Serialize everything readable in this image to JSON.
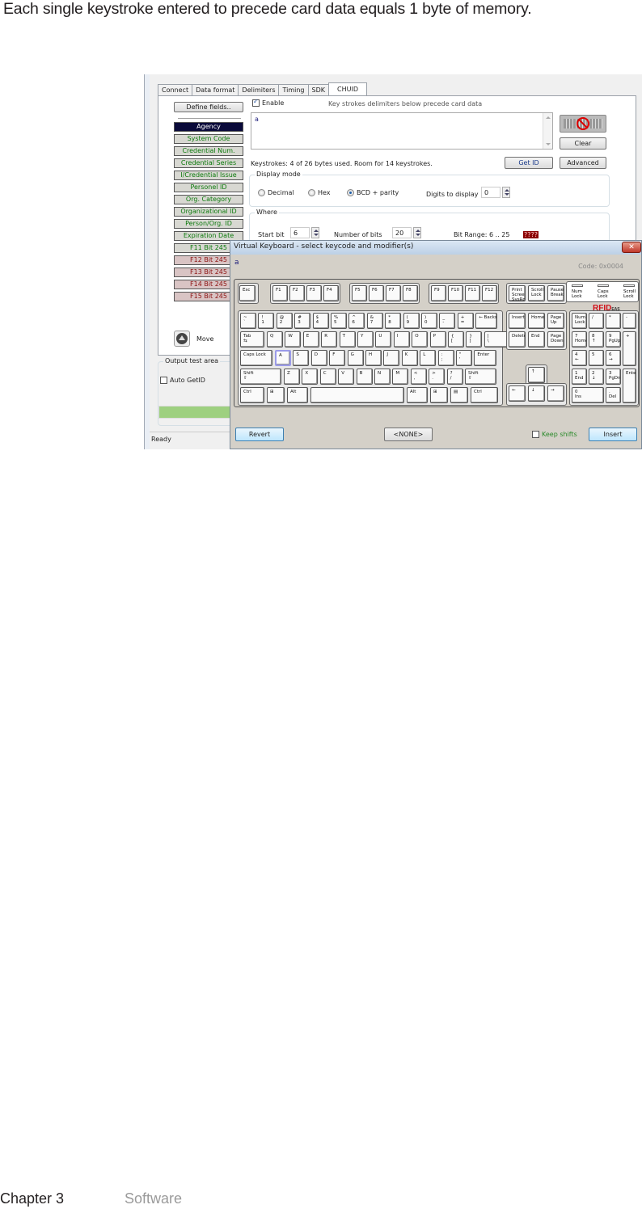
{
  "caption": "Each single keystroke entered to precede card data equals 1 byte of memory.",
  "footer": {
    "chapter": "Chapter 3",
    "section": "Software"
  },
  "app": {
    "tabs": [
      "Connect",
      "Data format",
      "Delimiters",
      "Timing",
      "SDK",
      "CHUID"
    ],
    "active_tab": "CHUID",
    "define_fields": "Define fields..",
    "fields": [
      {
        "label": "Agency",
        "state": "selected"
      },
      {
        "label": "System Code",
        "state": "green"
      },
      {
        "label": "Credential Num.",
        "state": "green"
      },
      {
        "label": "Credential Series",
        "state": "green"
      },
      {
        "label": "I/Credential Issue",
        "state": "green"
      },
      {
        "label": "Personel ID",
        "state": "green"
      },
      {
        "label": "Org. Category",
        "state": "green"
      },
      {
        "label": "Organizational ID",
        "state": "green"
      },
      {
        "label": "Person/Org. ID",
        "state": "green"
      },
      {
        "label": "Expiration Date",
        "state": "green"
      },
      {
        "label": "F11 Bit 245",
        "state": "green"
      },
      {
        "label": "F12 Bit 245",
        "state": "red"
      },
      {
        "label": "F13 Bit 245",
        "state": "red"
      },
      {
        "label": "F14 Bit 245",
        "state": "red"
      },
      {
        "label": "F15 Bit 245",
        "state": "red"
      }
    ],
    "move_label": "Move",
    "enable_label": "Enable",
    "enable_checked": true,
    "hint": "Key strokes delimiters below precede card data",
    "keystroke_value": "a",
    "clear": "Clear",
    "get_id": "Get ID",
    "advanced": "Advanced",
    "keystrokes_status": "Keystrokes: 4 of 26 bytes used. Room for 14 keystrokes.",
    "display_mode": {
      "title": "Display mode",
      "options": [
        "Decimal",
        "Hex",
        "BCD + parity"
      ],
      "selected": "BCD + parity",
      "digits_label": "Digits to display",
      "digits_value": "0"
    },
    "where": {
      "title": "Where",
      "start_bit_label": "Start bit",
      "start_bit": "6",
      "num_bits_label": "Number of bits",
      "num_bits": "20",
      "bit_range": "Bit Range: 6 .. 25",
      "bit_error": "????"
    },
    "output": {
      "title": "Output test area",
      "auto_getid": "Auto GetID",
      "auto_getid_checked": false
    },
    "status": "Ready"
  },
  "vk": {
    "title": "Virtual Keyboard - select keycode and modifier(s)",
    "close": "✕",
    "selected_char": "a",
    "code": "Code: 0x0004",
    "leds": [
      "Num\nLock",
      "Caps\nLock",
      "Scroll\nLock"
    ],
    "brand": "RFID",
    "brand_suffix": "EAS",
    "revert": "Revert",
    "none": "<NONE>",
    "keep_shifts": "Keep shifts",
    "insert": "Insert",
    "keys": {
      "esc": "Esc",
      "f": [
        "F1",
        "F2",
        "F3",
        "F4",
        "F5",
        "F6",
        "F7",
        "F8",
        "F9",
        "F10",
        "F11",
        "F12"
      ],
      "sys": [
        "Print\nScreen\nSysRq",
        "Scroll\nLock",
        "Pause\nBreak"
      ],
      "row1": [
        "~\n`",
        "!\n1",
        "@\n2",
        "#\n3",
        "$\n4",
        "%\n5",
        "^\n6",
        "&\n7",
        "*\n8",
        "(\n9",
        ")\n0",
        "_\n-",
        "+\n="
      ],
      "backspace": "← Backspace",
      "tab": "Tab\n⇆",
      "row2": [
        "Q",
        "W",
        "E",
        "R",
        "T",
        "Y",
        "U",
        "I",
        "O",
        "P",
        "{\n[",
        "}\n]",
        "|\n\\"
      ],
      "caps": "Caps Lock",
      "row3": [
        "A",
        "S",
        "D",
        "F",
        "G",
        "H",
        "J",
        "K",
        "L",
        ":\n;",
        "\"\n'"
      ],
      "enter": "Enter",
      "shift": "Shift\n⇧",
      "row4": [
        "Z",
        "X",
        "C",
        "V",
        "B",
        "N",
        "M",
        "<\n,",
        ">\n.",
        "?\n/"
      ],
      "ctrl": "Ctrl",
      "win": "⊞",
      "alt": "Alt",
      "menu": "▤",
      "nav": [
        "Insert",
        "Home",
        "Page\nUp",
        "Delete",
        "End",
        "Page\nDown"
      ],
      "arrows": [
        "↑",
        "←",
        "↓",
        "→"
      ],
      "numpad": [
        "Num\nLock",
        "/",
        "*",
        "-",
        "7\nHome",
        "8\n↑",
        "9\nPgUp",
        "+",
        "4\n←",
        "5",
        "6\n→",
        "1\nEnd",
        "2\n↓",
        "3\nPgDn",
        "Enter",
        "0\nIns",
        ".\nDel"
      ]
    }
  }
}
